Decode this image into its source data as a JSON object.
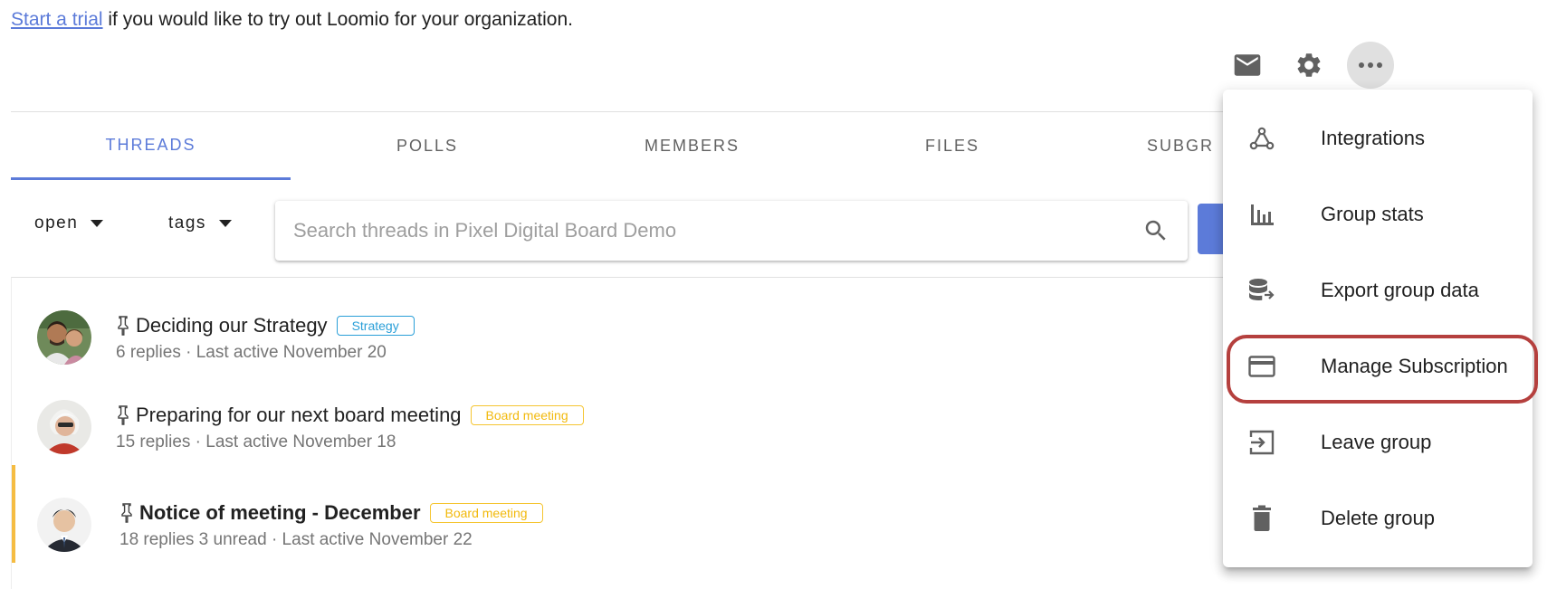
{
  "banner": {
    "link_text": "Start a trial",
    "text": " if you would like to try out Loomio for your organization."
  },
  "group_actions": {
    "icons": [
      "email-icon",
      "gear-icon",
      "more-horizontal-icon"
    ]
  },
  "tabs": [
    {
      "label": "THREADS",
      "active": true
    },
    {
      "label": "POLLS",
      "active": false
    },
    {
      "label": "MEMBERS",
      "active": false
    },
    {
      "label": "FILES",
      "active": false
    },
    {
      "label": "SUBGR",
      "active": false
    }
  ],
  "filters": {
    "status_label": "open",
    "tags_label": "tags"
  },
  "search": {
    "placeholder": "Search threads in Pixel Digital Board Demo",
    "value": ""
  },
  "threads": [
    {
      "title": "Deciding our Strategy",
      "tag": "Strategy",
      "tag_color": "#2a9fd8",
      "meta": "6 replies  · Last active November 20",
      "pinned": true,
      "unread": false
    },
    {
      "title": "Preparing for our next board meeting",
      "tag": "Board meeting",
      "tag_color": "#f2b90c",
      "meta": "15 replies  · Last active November 18",
      "pinned": true,
      "unread": false
    },
    {
      "title": "Notice of meeting - December",
      "tag": "Board meeting",
      "tag_color": "#f2b90c",
      "meta": "18 replies 3 unread · Last active November 22",
      "pinned": true,
      "unread": true
    }
  ],
  "menu": {
    "items": [
      {
        "label": "Integrations",
        "icon": "webhook-icon"
      },
      {
        "label": "Group stats",
        "icon": "bar-chart-icon"
      },
      {
        "label": "Export group data",
        "icon": "database-export-icon"
      },
      {
        "label": "Manage Subscription",
        "icon": "credit-card-icon",
        "highlighted": true
      },
      {
        "label": "Leave group",
        "icon": "exit-icon"
      },
      {
        "label": "Delete group",
        "icon": "trash-icon"
      }
    ]
  },
  "colors": {
    "accent": "#5c7bd9",
    "unread_bar": "#f5bc42",
    "highlight_ring": "#b5403e"
  }
}
